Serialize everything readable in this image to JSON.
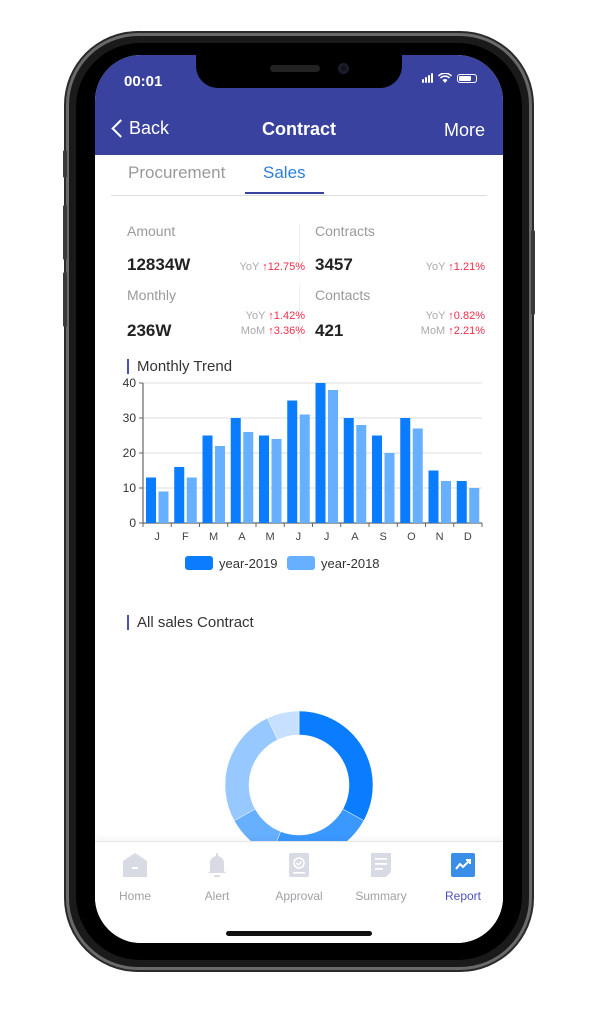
{
  "status_bar": {
    "time": "00:01"
  },
  "nav": {
    "back_label": "Back",
    "title": "Contract",
    "more_label": "More"
  },
  "tabs": [
    {
      "label": "Procurement",
      "active": false
    },
    {
      "label": "Sales",
      "active": true
    }
  ],
  "stats": {
    "amount": {
      "label": "Amount",
      "value": "12834W",
      "yoy_label": "YoY",
      "yoy": "12.75%"
    },
    "contracts": {
      "label": "Contracts",
      "value": "3457",
      "yoy_label": "YoY",
      "yoy": "1.21%"
    },
    "monthly": {
      "label": "Monthly",
      "value": "236W",
      "yoy_label": "YoY",
      "yoy": "1.42%",
      "mom_label": "MoM",
      "mom": "3.36%"
    },
    "contacts": {
      "label": "Contacts",
      "value": "421",
      "yoy_label": "YoY",
      "yoy": "0.82%",
      "mom_label": "MoM",
      "mom": "2.21%"
    }
  },
  "sections": {
    "trend_title": "Monthly Trend",
    "donut_title": "All sales Contract"
  },
  "colors": {
    "header": "#3a42a0",
    "accent": "#2b7fdb",
    "up": "#ee2d4a",
    "series2019": "#0a7dff",
    "series2018": "#66b0ff"
  },
  "chart_data": [
    {
      "type": "bar",
      "title": "Monthly Trend",
      "categories": [
        "J",
        "F",
        "M",
        "A",
        "M",
        "J",
        "J",
        "A",
        "S",
        "O",
        "N",
        "D"
      ],
      "series": [
        {
          "name": "year-2019",
          "color": "#0a7dff",
          "values": [
            13,
            16,
            25,
            30,
            25,
            35,
            40,
            30,
            25,
            30,
            15,
            12
          ]
        },
        {
          "name": "year-2018",
          "color": "#66b0ff",
          "values": [
            9,
            13,
            22,
            26,
            24,
            31,
            38,
            28,
            20,
            27,
            12,
            10
          ]
        }
      ],
      "yticks": [
        0,
        10,
        20,
        30,
        40
      ],
      "ylim": [
        0,
        40
      ],
      "grid": true,
      "legend": "bottom",
      "xlabel": "",
      "ylabel": ""
    },
    {
      "type": "pie",
      "title": "All sales Contract",
      "donut": true,
      "slices": [
        {
          "value": 33,
          "color": "#0a7dff"
        },
        {
          "value": 23,
          "color": "#3a98ff"
        },
        {
          "value": 11,
          "color": "#66b0ff"
        },
        {
          "value": 26,
          "color": "#97c8ff"
        },
        {
          "value": 7,
          "color": "#c8e0ff"
        }
      ]
    }
  ],
  "tabbar": [
    {
      "label": "Home",
      "icon": "home-icon",
      "active": false
    },
    {
      "label": "Alert",
      "icon": "bell-icon",
      "active": false
    },
    {
      "label": "Approval",
      "icon": "approval-icon",
      "active": false
    },
    {
      "label": "Summary",
      "icon": "document-icon",
      "active": false
    },
    {
      "label": "Report",
      "icon": "chart-trend-icon",
      "active": true
    }
  ]
}
